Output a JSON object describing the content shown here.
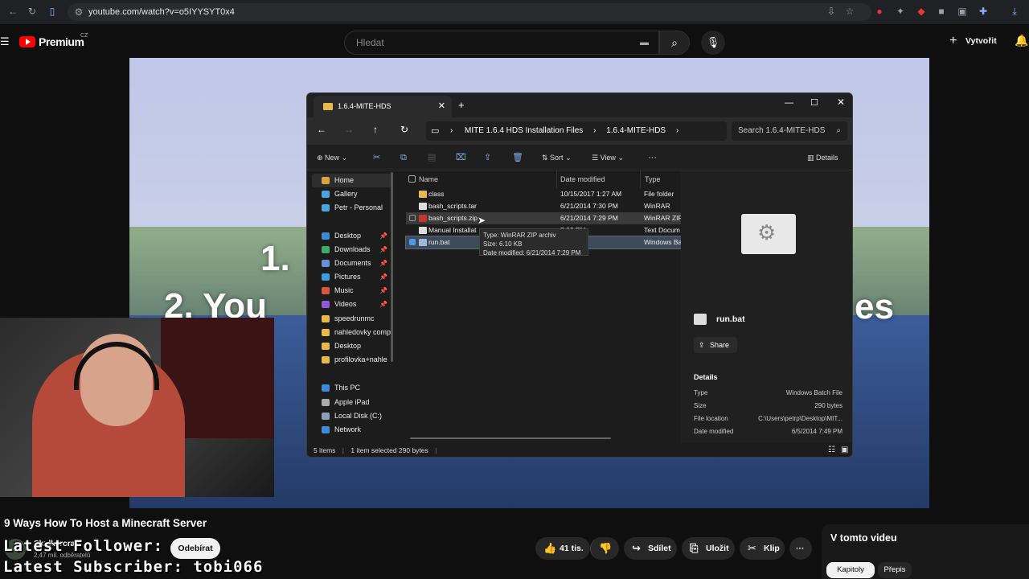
{
  "browser": {
    "url": "youtube.com/watch?v=o5IYYSYT0x4"
  },
  "youtube": {
    "brand": "Premium",
    "region": "CZ",
    "search_placeholder": "Hledat",
    "create_label": "Vytvořit"
  },
  "video_overlay": {
    "line1": "1.",
    "line2": "2. You",
    "line3": "es"
  },
  "explorer": {
    "tab_title": "1.6.4-MITE-HDS",
    "breadcrumb": [
      "MITE 1.6.4 HDS Installation Files",
      "1.6.4-MITE-HDS"
    ],
    "search_placeholder": "Search 1.6.4-MITE-HDS",
    "commands": {
      "new": "New",
      "sort": "Sort",
      "view": "View",
      "more": "···",
      "details": "Details"
    },
    "sidebar": [
      {
        "label": "Home",
        "color": "#d9a440"
      },
      {
        "label": "Gallery",
        "color": "#4aa3df"
      },
      {
        "label": "Petr - Personal",
        "color": "#4aa3df"
      },
      {
        "label": "Desktop",
        "color": "#3d8bd8",
        "pinned": true
      },
      {
        "label": "Downloads",
        "color": "#3daa6b",
        "pinned": true
      },
      {
        "label": "Documents",
        "color": "#6b8fd6",
        "pinned": true
      },
      {
        "label": "Pictures",
        "color": "#3d9be0",
        "pinned": true
      },
      {
        "label": "Music",
        "color": "#d8573d",
        "pinned": true
      },
      {
        "label": "Videos",
        "color": "#8d5bd8",
        "pinned": true
      },
      {
        "label": "speedrunmc",
        "color": "#e8b84a"
      },
      {
        "label": "nahledovky comp",
        "color": "#e8b84a"
      },
      {
        "label": "Desktop",
        "color": "#e8b84a"
      },
      {
        "label": "profilovka+nahle",
        "color": "#e8b84a"
      },
      {
        "label": "This PC",
        "color": "#3d8bd8"
      },
      {
        "label": "Apple iPad",
        "color": "#aaaaaa"
      },
      {
        "label": "Local Disk (C:)",
        "color": "#8aa0b8"
      },
      {
        "label": "Network",
        "color": "#3d8bd8"
      }
    ],
    "columns": {
      "name": "Name",
      "date": "Date modified",
      "type": "Type"
    },
    "files": [
      {
        "name": "class",
        "date": "10/15/2017 1:27 AM",
        "type": "File folder",
        "icon": "folder"
      },
      {
        "name": "bash_scripts.tar",
        "date": "6/21/2014 7:30 PM",
        "type": "WinRAR",
        "icon": "file"
      },
      {
        "name": "bash_scripts.zip",
        "date": "6/21/2014 7:29 PM",
        "type": "WinRAR ZIP",
        "icon": "zip"
      },
      {
        "name": "Manual Installat",
        "date": "7:32 PM",
        "type": "Text Docum",
        "icon": "file"
      },
      {
        "name": "run.bat",
        "date": "7:49 PM",
        "type": "Windows Ba",
        "icon": "bat"
      }
    ],
    "tooltip": {
      "type": "Type: WinRAR ZIP archiv",
      "size": "Size: 6.10 KB",
      "date": "Date modified: 6/21/2014 7:29 PM"
    },
    "preview": {
      "filename": "run.bat",
      "share": "Share",
      "details_heading": "Details",
      "props": [
        {
          "key": "Type",
          "value": "Windows Batch File"
        },
        {
          "key": "Size",
          "value": "290 bytes"
        },
        {
          "key": "File location",
          "value": "C:\\Users\\petrp\\Desktop\\MIT..."
        },
        {
          "key": "Date modified",
          "value": "6/5/2014 7:49 PM"
        }
      ]
    },
    "status": {
      "items": "5 items",
      "selected": "1 item selected  290 bytes"
    }
  },
  "video": {
    "title": "9 Ways How To Host a Minecraft Server",
    "channel": "Skulkercraft",
    "subscribers": "2,47 mil. odběratelů",
    "subscribe_label": "Odebírat",
    "likes": "41 tis.",
    "share": "Sdílet",
    "save": "Uložit",
    "clip": "Klip",
    "more": "···"
  },
  "stream_overlay": {
    "follower": "Latest Follower:",
    "subscriber": "Latest Subscriber: tobi066"
  },
  "side_panel": {
    "title": "V tomto videu",
    "tab_chapters": "Kapitoly",
    "tab_transcript": "Přepis"
  }
}
